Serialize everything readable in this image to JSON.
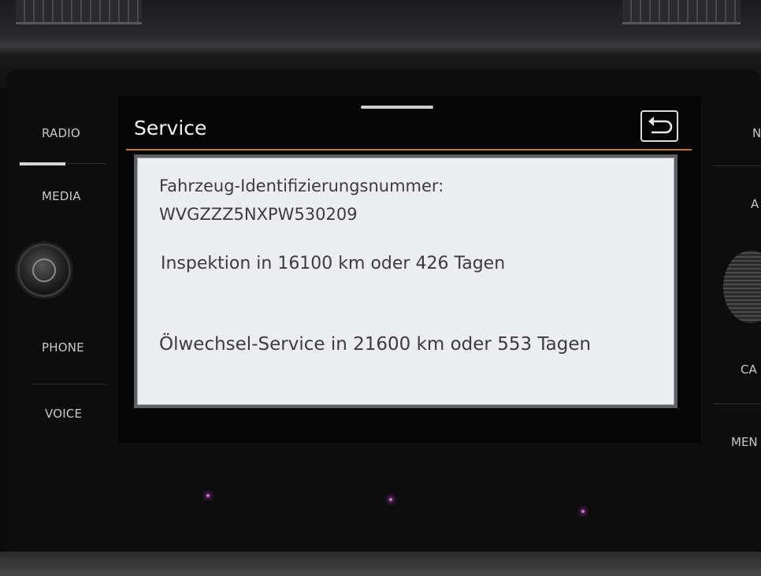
{
  "screen": {
    "title": "Service",
    "back_icon": "back-arrow-icon",
    "accent_color": "#c77a1c"
  },
  "left_buttons": [
    "RADIO",
    "MEDIA",
    "PHONE",
    "VOICE"
  ],
  "right_buttons": [
    "N",
    "A",
    "CA",
    "MEN"
  ],
  "service_info": {
    "vin_label": "Fahrzeug-Identifizierungsnummer:",
    "vin_value": "WVGZZZ5NXPW530209",
    "inspection": "Inspektion in 16100 km oder 426 Tagen",
    "oil_service": "Ölwechsel-Service in 21600 km oder 553 Tagen"
  }
}
